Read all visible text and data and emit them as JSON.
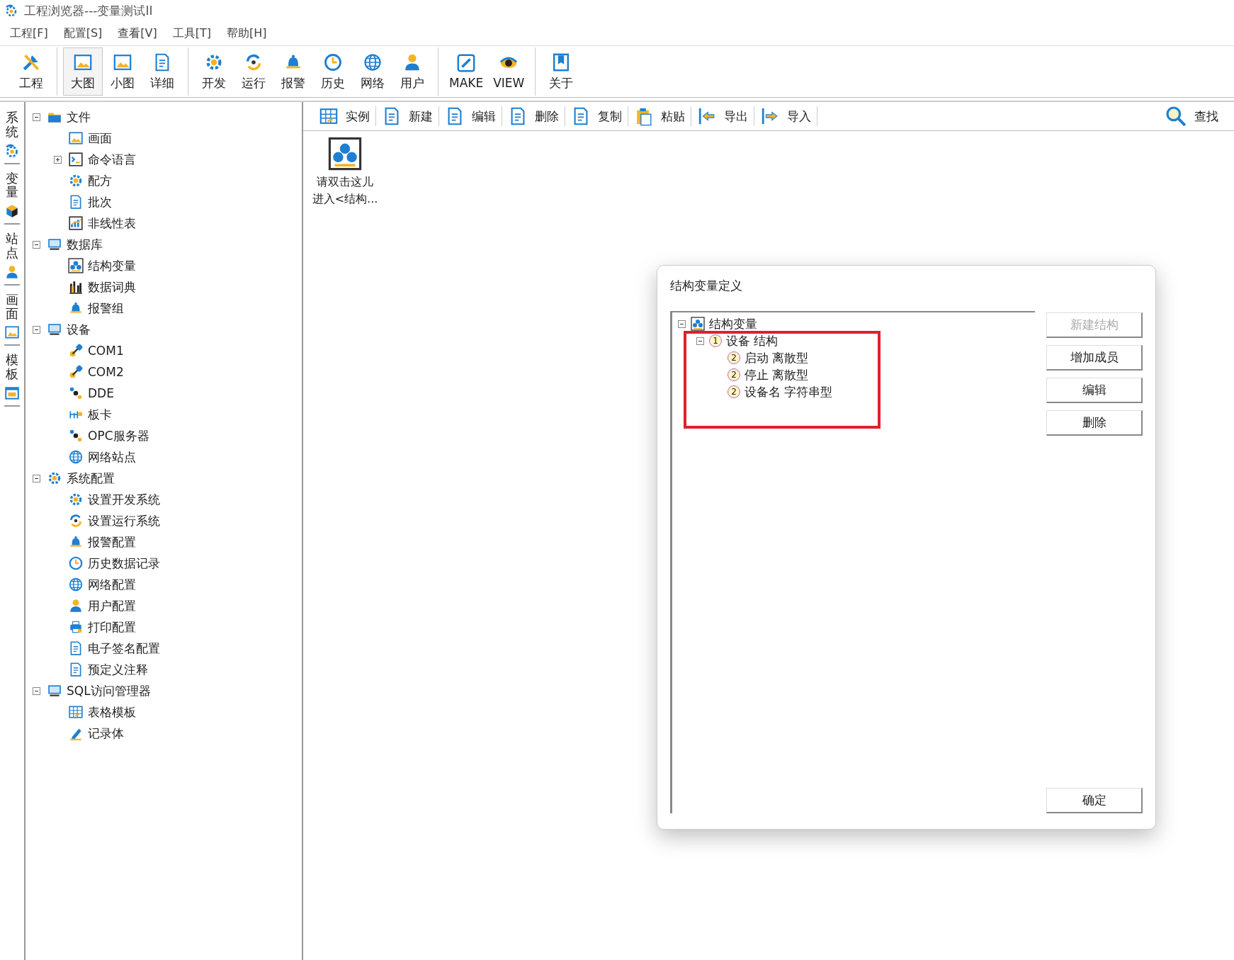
{
  "window": {
    "title": "工程浏览器---变量测试II"
  },
  "menu": [
    "工程[F]",
    "配置[S]",
    "查看[V]",
    "工具[T]",
    "帮助[H]"
  ],
  "toolbar": {
    "groups": [
      [
        {
          "label": "工程",
          "selected": false
        }
      ],
      [
        {
          "label": "大图",
          "selected": true
        },
        {
          "label": "小图",
          "selected": false
        },
        {
          "label": "详细",
          "selected": false
        }
      ],
      [
        {
          "label": "开发",
          "selected": false
        },
        {
          "label": "运行",
          "selected": false
        },
        {
          "label": "报警",
          "selected": false
        },
        {
          "label": "历史",
          "selected": false
        },
        {
          "label": "网络",
          "selected": false
        },
        {
          "label": "用户",
          "selected": false
        }
      ],
      [
        {
          "label": "MAKE",
          "selected": false
        },
        {
          "label": "VIEW",
          "selected": false
        }
      ],
      [
        {
          "label": "关于",
          "selected": false
        }
      ]
    ]
  },
  "side_tabs": [
    "系统",
    "变量",
    "站点",
    "画面",
    "模板"
  ],
  "tree": [
    {
      "label": "文件",
      "expanded": true,
      "children": [
        {
          "label": "画面"
        },
        {
          "label": "命令语言",
          "expanded": false
        },
        {
          "label": "配方"
        },
        {
          "label": "批次"
        },
        {
          "label": "非线性表"
        }
      ]
    },
    {
      "label": "数据库",
      "expanded": true,
      "children": [
        {
          "label": "结构变量"
        },
        {
          "label": "数据词典"
        },
        {
          "label": "报警组"
        }
      ]
    },
    {
      "label": "设备",
      "expanded": true,
      "children": [
        {
          "label": "COM1"
        },
        {
          "label": "COM2"
        },
        {
          "label": "DDE"
        },
        {
          "label": "板卡"
        },
        {
          "label": "OPC服务器"
        },
        {
          "label": "网络站点"
        }
      ]
    },
    {
      "label": "系统配置",
      "expanded": true,
      "children": [
        {
          "label": "设置开发系统"
        },
        {
          "label": "设置运行系统"
        },
        {
          "label": "报警配置"
        },
        {
          "label": "历史数据记录"
        },
        {
          "label": "网络配置"
        },
        {
          "label": "用户配置"
        },
        {
          "label": "打印配置"
        },
        {
          "label": "电子签名配置"
        },
        {
          "label": "预定义注释"
        }
      ]
    },
    {
      "label": "SQL访问管理器",
      "expanded": true,
      "children": [
        {
          "label": "表格模板"
        },
        {
          "label": "记录体"
        }
      ]
    }
  ],
  "content_toolbar": {
    "items": [
      "实例",
      "新建",
      "编辑",
      "删除",
      "复制",
      "粘贴",
      "导出",
      "导入"
    ],
    "search": "查找"
  },
  "content_items": [
    {
      "lines": [
        "请双击这儿",
        "进入<结构..."
      ]
    }
  ],
  "dialog": {
    "title": "结构变量定义",
    "tree": [
      {
        "label": "结构变量",
        "expanded": true,
        "children": [
          {
            "label": "设备 结构",
            "badge": "1",
            "expanded": true,
            "children": [
              {
                "label": "启动 离散型",
                "badge": "2"
              },
              {
                "label": "停止 离散型",
                "badge": "2"
              },
              {
                "label": "设备名 字符串型",
                "badge": "2"
              }
            ]
          }
        ]
      }
    ],
    "buttons": [
      {
        "label": "新建结构",
        "disabled": true
      },
      {
        "label": "增加成员",
        "disabled": false
      },
      {
        "label": "编辑",
        "disabled": false
      },
      {
        "label": "删除",
        "disabled": false
      }
    ],
    "ok_button": "确定"
  }
}
